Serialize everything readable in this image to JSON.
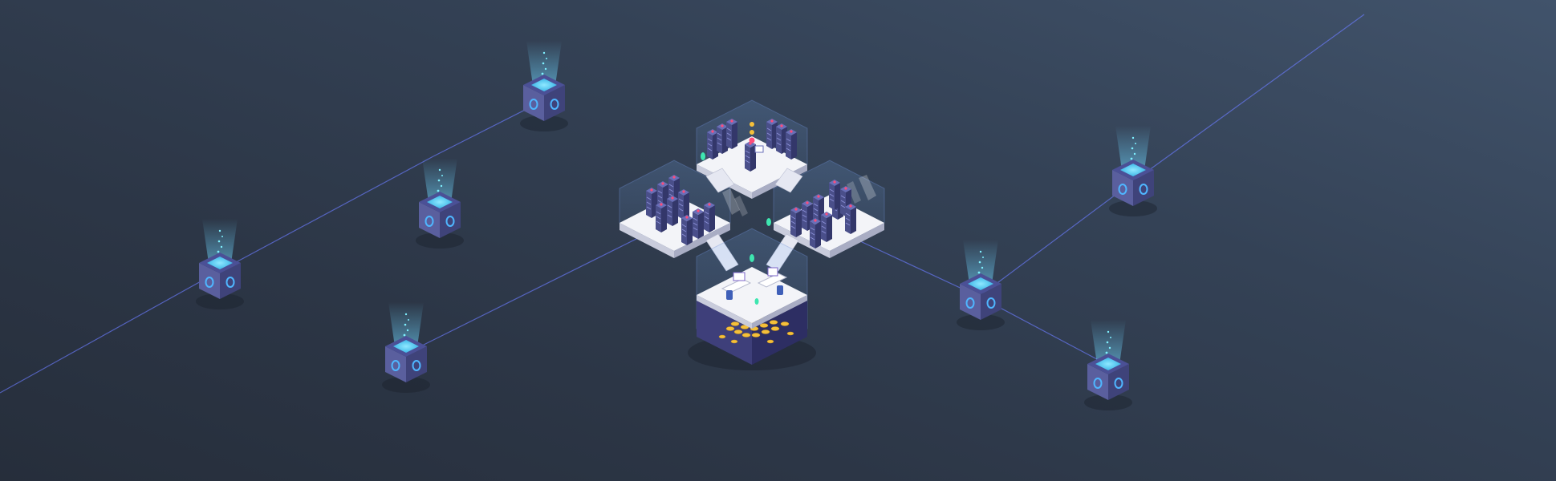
{
  "scene": {
    "description_tag": "isometric-blockchain-mining-illustration",
    "palette": {
      "background_top": "#41536b",
      "background_bottom": "#262e3b",
      "cube_top": "#6ad7f2",
      "cube_side_left": "#5a5f9e",
      "cube_side_right": "#3f437a",
      "beam": "#6fd6ff",
      "link_line": "#6b7cff",
      "server_rack": "#4a4f8a",
      "floor": "#f3f4f8",
      "coins": "#f5c03a",
      "accent_red": "#ff4d7a",
      "plant": "#3ee6b0"
    }
  }
}
